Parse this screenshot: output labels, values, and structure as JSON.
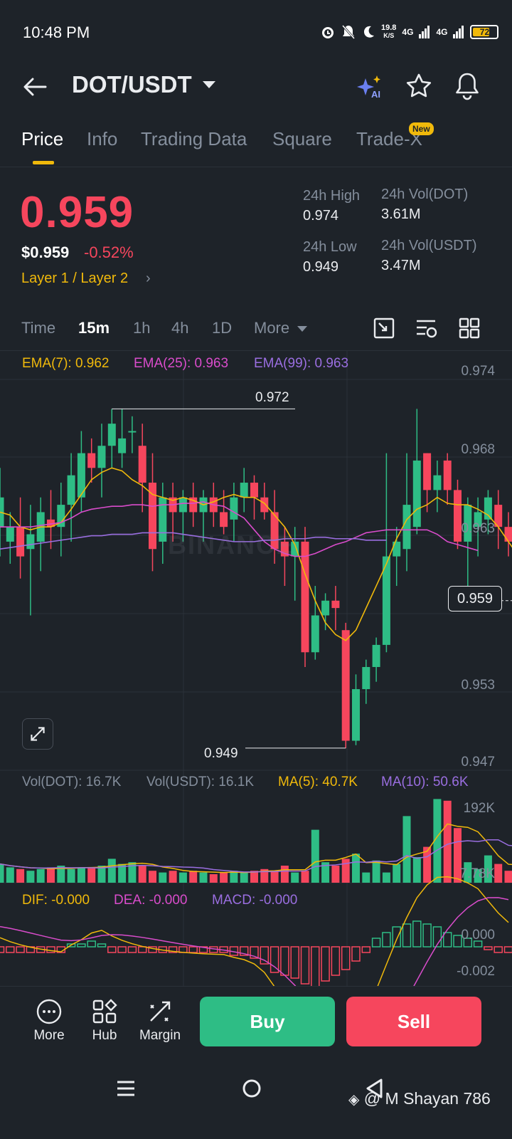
{
  "status_bar": {
    "time": "10:48 PM",
    "net_speed": "19.8",
    "net_unit": "K/S",
    "net1": "4G",
    "net2": "4G",
    "battery": "72",
    "battery_level": 0.72
  },
  "header": {
    "pair": "DOT/USDT",
    "icons": [
      "back-arrow-icon",
      "ai-sparkle-icon",
      "star-icon",
      "bell-icon"
    ]
  },
  "tabs": [
    {
      "label": "Price",
      "active": true
    },
    {
      "label": "Info"
    },
    {
      "label": "Trading Data"
    },
    {
      "label": "Square"
    },
    {
      "label": "Trade-X",
      "badge": "New"
    }
  ],
  "price": {
    "last": "0.959",
    "usd": "$0.959",
    "change": "-0.52%",
    "category": "Layer 1 / Layer 2",
    "high_label": "24h High",
    "high_value": "0.974",
    "low_label": "24h Low",
    "low_value": "0.949",
    "vol_base_label": "24h Vol(DOT)",
    "vol_base_value": "3.61M",
    "vol_quote_label": "24h Vol(USDT)",
    "vol_quote_value": "3.47M"
  },
  "intervals": {
    "items": [
      "Time",
      "15m",
      "1h",
      "4h",
      "1D",
      "More"
    ],
    "active": "15m"
  },
  "indicators": {
    "ema7": "EMA(7): 0.962",
    "ema25": "EMA(25): 0.963",
    "ema99": "EMA(99): 0.963",
    "vol_dot": "Vol(DOT): 16.7K",
    "vol_usdt": "Vol(USDT): 16.1K",
    "ma5": "MA(5): 40.7K",
    "ma10": "MA(10): 50.6K",
    "dif": "DIF: -0.000",
    "dea": "DEA: -0.000",
    "macd": "MACD: -0.000"
  },
  "colors": {
    "up": "#2ebd85",
    "down": "#f6465d",
    "ema7": "#f0b90b",
    "ema25": "#d94ccb",
    "ema99": "#9a6ee0",
    "accent": "#f0b90b"
  },
  "chart_data": [
    {
      "type": "candlestick",
      "y_axis_labels": [
        "0.974",
        "0.968",
        "0.963",
        "0.958",
        "0.953",
        "0.947"
      ],
      "ylim": [
        0.947,
        0.974
      ],
      "high_marker": "0.972",
      "low_marker": "0.949",
      "current_price": "0.959",
      "candles": [
        {
          "o": 0.964,
          "h": 0.968,
          "l": 0.962,
          "c": 0.966
        },
        {
          "o": 0.963,
          "h": 0.965,
          "l": 0.9615,
          "c": 0.964
        },
        {
          "o": 0.964,
          "h": 0.966,
          "l": 0.9605,
          "c": 0.962
        },
        {
          "o": 0.9625,
          "h": 0.9655,
          "l": 0.958,
          "c": 0.9635
        },
        {
          "o": 0.963,
          "h": 0.966,
          "l": 0.961,
          "c": 0.965
        },
        {
          "o": 0.9645,
          "h": 0.9665,
          "l": 0.9625,
          "c": 0.964
        },
        {
          "o": 0.964,
          "h": 0.967,
          "l": 0.962,
          "c": 0.9655
        },
        {
          "o": 0.9655,
          "h": 0.969,
          "l": 0.963,
          "c": 0.9675
        },
        {
          "o": 0.966,
          "h": 0.9705,
          "l": 0.965,
          "c": 0.969
        },
        {
          "o": 0.969,
          "h": 0.97,
          "l": 0.967,
          "c": 0.968
        },
        {
          "o": 0.968,
          "h": 0.971,
          "l": 0.966,
          "c": 0.9695
        },
        {
          "o": 0.9695,
          "h": 0.972,
          "l": 0.968,
          "c": 0.971
        },
        {
          "o": 0.969,
          "h": 0.972,
          "l": 0.968,
          "c": 0.97
        },
        {
          "o": 0.9705,
          "h": 0.9715,
          "l": 0.969,
          "c": 0.9705
        },
        {
          "o": 0.9695,
          "h": 0.971,
          "l": 0.965,
          "c": 0.967
        },
        {
          "o": 0.967,
          "h": 0.969,
          "l": 0.961,
          "c": 0.9625
        },
        {
          "o": 0.963,
          "h": 0.967,
          "l": 0.9615,
          "c": 0.966
        },
        {
          "o": 0.966,
          "h": 0.967,
          "l": 0.963,
          "c": 0.965
        },
        {
          "o": 0.965,
          "h": 0.9665,
          "l": 0.963,
          "c": 0.966
        },
        {
          "o": 0.966,
          "h": 0.967,
          "l": 0.964,
          "c": 0.965
        },
        {
          "o": 0.965,
          "h": 0.9665,
          "l": 0.963,
          "c": 0.966
        },
        {
          "o": 0.966,
          "h": 0.967,
          "l": 0.964,
          "c": 0.965
        },
        {
          "o": 0.965,
          "h": 0.9665,
          "l": 0.9635,
          "c": 0.964
        },
        {
          "o": 0.9645,
          "h": 0.967,
          "l": 0.963,
          "c": 0.966
        },
        {
          "o": 0.966,
          "h": 0.968,
          "l": 0.965,
          "c": 0.967
        },
        {
          "o": 0.967,
          "h": 0.9675,
          "l": 0.9645,
          "c": 0.966
        },
        {
          "o": 0.966,
          "h": 0.967,
          "l": 0.9645,
          "c": 0.965
        },
        {
          "o": 0.965,
          "h": 0.9665,
          "l": 0.9615,
          "c": 0.9625
        },
        {
          "o": 0.963,
          "h": 0.964,
          "l": 0.96,
          "c": 0.962
        },
        {
          "o": 0.962,
          "h": 0.964,
          "l": 0.959,
          "c": 0.963
        },
        {
          "o": 0.963,
          "h": 0.964,
          "l": 0.9545,
          "c": 0.9555
        },
        {
          "o": 0.9555,
          "h": 0.96,
          "l": 0.955,
          "c": 0.958
        },
        {
          "o": 0.958,
          "h": 0.9595,
          "l": 0.957,
          "c": 0.959
        },
        {
          "o": 0.959,
          "h": 0.96,
          "l": 0.957,
          "c": 0.9585
        },
        {
          "o": 0.957,
          "h": 0.9575,
          "l": 0.949,
          "c": 0.9495
        },
        {
          "o": 0.9495,
          "h": 0.954,
          "l": 0.9492,
          "c": 0.953
        },
        {
          "o": 0.953,
          "h": 0.955,
          "l": 0.952,
          "c": 0.9545
        },
        {
          "o": 0.9545,
          "h": 0.9565,
          "l": 0.9535,
          "c": 0.956
        },
        {
          "o": 0.956,
          "h": 0.969,
          "l": 0.9555,
          "c": 0.962
        },
        {
          "o": 0.962,
          "h": 0.964,
          "l": 0.96,
          "c": 0.963
        },
        {
          "o": 0.9625,
          "h": 0.969,
          "l": 0.961,
          "c": 0.9655
        },
        {
          "o": 0.964,
          "h": 0.972,
          "l": 0.9635,
          "c": 0.9685
        },
        {
          "o": 0.969,
          "h": 0.969,
          "l": 0.965,
          "c": 0.9665
        },
        {
          "o": 0.9665,
          "h": 0.9685,
          "l": 0.965,
          "c": 0.9675
        },
        {
          "o": 0.9685,
          "h": 0.969,
          "l": 0.9655,
          "c": 0.9665
        },
        {
          "o": 0.9665,
          "h": 0.9672,
          "l": 0.9625,
          "c": 0.963
        },
        {
          "o": 0.963,
          "h": 0.966,
          "l": 0.96,
          "c": 0.9655
        },
        {
          "o": 0.964,
          "h": 0.966,
          "l": 0.962,
          "c": 0.965
        },
        {
          "o": 0.9645,
          "h": 0.9665,
          "l": 0.9635,
          "c": 0.966
        },
        {
          "o": 0.9655,
          "h": 0.9665,
          "l": 0.9625,
          "c": 0.964
        },
        {
          "o": 0.964,
          "h": 0.965,
          "l": 0.962,
          "c": 0.963
        },
        {
          "o": 0.9635,
          "h": 0.9645,
          "l": 0.9585,
          "c": 0.9615
        },
        {
          "o": 0.961,
          "h": 0.962,
          "l": 0.955,
          "c": 0.96
        },
        {
          "o": 0.96,
          "h": 0.9605,
          "l": 0.9585,
          "c": 0.959
        }
      ],
      "ema7": [
        0.965,
        0.9648,
        0.964,
        0.9638,
        0.964,
        0.964,
        0.9643,
        0.9652,
        0.9662,
        0.9672,
        0.9677,
        0.968,
        0.9678,
        0.9672,
        0.9668,
        0.9662,
        0.966,
        0.9658,
        0.966,
        0.9658,
        0.9655,
        0.9657,
        0.966,
        0.9662,
        0.966,
        0.966,
        0.9656,
        0.9648,
        0.964,
        0.9628,
        0.9608,
        0.959,
        0.9575,
        0.9567,
        0.9563,
        0.957,
        0.9585,
        0.96,
        0.9615,
        0.9632,
        0.9645,
        0.9652,
        0.9655,
        0.966,
        0.9656,
        0.9655,
        0.9655,
        0.9652,
        0.9648,
        0.964,
        0.963,
        0.962,
        0.961
      ],
      "ema25": [
        0.964,
        0.964,
        0.964,
        0.964,
        0.9641,
        0.9642,
        0.9643,
        0.9646,
        0.965,
        0.9652,
        0.9653,
        0.9654,
        0.9654,
        0.9655,
        0.9655,
        0.9654,
        0.9655,
        0.9655,
        0.9656,
        0.9656,
        0.9657,
        0.9655,
        0.9654,
        0.965,
        0.9646,
        0.9638,
        0.963,
        0.9625,
        0.9622,
        0.962,
        0.962,
        0.9622,
        0.9625,
        0.9628,
        0.963,
        0.9633,
        0.9636,
        0.9637,
        0.9638,
        0.9638,
        0.9638,
        0.9638,
        0.9638,
        0.9635,
        0.963,
        0.9628,
        0.9626,
        0.9624
      ],
      "ema99": [
        0.9625,
        0.9626,
        0.9627,
        0.9628,
        0.9629,
        0.963,
        0.9631,
        0.9632,
        0.9633,
        0.9634,
        0.9634,
        0.9635,
        0.9635,
        0.9635,
        0.9636,
        0.9636,
        0.9636,
        0.9636,
        0.9635,
        0.9634,
        0.9633,
        0.9632,
        0.9631,
        0.963,
        0.963,
        0.963,
        0.9631,
        0.9631,
        0.9632,
        0.9632,
        0.9632,
        0.9633,
        0.9633,
        0.9632,
        0.9632,
        0.9632,
        0.9631,
        0.9631,
        0.9631
      ]
    },
    {
      "type": "bar",
      "y_axis_labels": [
        "192K",
        "7.78K"
      ],
      "ylim": [
        0,
        192
      ],
      "volumes": [
        22,
        18,
        16,
        14,
        16,
        18,
        20,
        16,
        18,
        17,
        20,
        28,
        22,
        24,
        20,
        14,
        12,
        14,
        12,
        14,
        12,
        10,
        12,
        14,
        12,
        14,
        16,
        14,
        20,
        12,
        14,
        62,
        24,
        20,
        28,
        34,
        12,
        26,
        12,
        22,
        78,
        30,
        42,
        98,
        96,
        64,
        24,
        16,
        32,
        22,
        14,
        20,
        36,
        18,
        10
      ]
    },
    {
      "type": "bar",
      "y_axis_labels": [
        "0.000",
        "-0.002"
      ],
      "ylim": [
        -0.0025,
        0.0012
      ],
      "macd": [
        -0.0002,
        -0.0002,
        -0.0002,
        -0.0002,
        -0.0002,
        -0.0002,
        -0.0002,
        0.0001,
        0.0001,
        0.0002,
        0.0001,
        -0.0002,
        -0.0002,
        -0.0002,
        -0.0002,
        -0.0002,
        -0.0002,
        -0.0002,
        -0.0002,
        -0.0002,
        -0.0002,
        -0.0002,
        -0.0002,
        -0.0003,
        -0.0003,
        -0.0004,
        -0.0006,
        -0.0009,
        -0.001,
        -0.0011,
        -0.0013,
        -0.0014,
        -0.0012,
        -0.001,
        -0.0008,
        -0.0005,
        -0.0002,
        0.0003,
        0.0005,
        0.0007,
        0.0008,
        0.0009,
        0.0008,
        0.0007,
        0.0005,
        0.0004,
        0.0003,
        0.0002,
        -0.0001,
        -0.0002,
        -0.0002
      ]
    }
  ],
  "bottom_bar": {
    "more": "More",
    "hub": "Hub",
    "margin": "Margin",
    "buy": "Buy",
    "sell": "Sell"
  },
  "watermark": "BINANCE",
  "credit": "@ M Shayan 786"
}
